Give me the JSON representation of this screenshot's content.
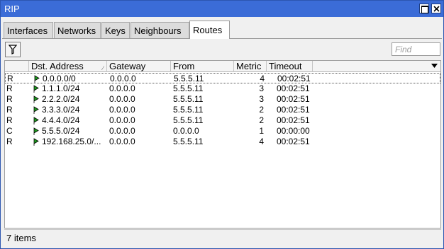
{
  "window": {
    "title": "RIP"
  },
  "tabs": [
    {
      "label": "Interfaces",
      "active": false
    },
    {
      "label": "Networks",
      "active": false
    },
    {
      "label": "Keys",
      "active": false
    },
    {
      "label": "Neighbours",
      "active": false
    },
    {
      "label": "Routes",
      "active": true
    }
  ],
  "toolbar": {
    "filter_icon": "filter-icon",
    "find_placeholder": "Find"
  },
  "table": {
    "columns": [
      "",
      "Dst. Address",
      "Gateway",
      "From",
      "Metric",
      "Timeout"
    ],
    "sort_column": "Dst. Address",
    "rows": [
      {
        "flag": "R",
        "dst": "0.0.0.0/0",
        "gateway": "0.0.0.0",
        "from": "5.5.5.11",
        "metric": "4",
        "timeout": "00:02:51"
      },
      {
        "flag": "R",
        "dst": "1.1.1.0/24",
        "gateway": "0.0.0.0",
        "from": "5.5.5.11",
        "metric": "3",
        "timeout": "00:02:51"
      },
      {
        "flag": "R",
        "dst": "2.2.2.0/24",
        "gateway": "0.0.0.0",
        "from": "5.5.5.11",
        "metric": "3",
        "timeout": "00:02:51"
      },
      {
        "flag": "R",
        "dst": "3.3.3.0/24",
        "gateway": "0.0.0.0",
        "from": "5.5.5.11",
        "metric": "2",
        "timeout": "00:02:51"
      },
      {
        "flag": "R",
        "dst": "4.4.4.0/24",
        "gateway": "0.0.0.0",
        "from": "5.5.5.11",
        "metric": "2",
        "timeout": "00:02:51"
      },
      {
        "flag": "C",
        "dst": "5.5.5.0/24",
        "gateway": "0.0.0.0",
        "from": "0.0.0.0",
        "metric": "1",
        "timeout": "00:00:00"
      },
      {
        "flag": "R",
        "dst": "192.168.25.0/...",
        "gateway": "0.0.0.0",
        "from": "5.5.5.11",
        "metric": "4",
        "timeout": "00:02:51"
      }
    ]
  },
  "status": {
    "items_text": "7 items"
  },
  "colors": {
    "titlebar": "#3b6cd7",
    "route_icon": "#1e9a1e"
  }
}
